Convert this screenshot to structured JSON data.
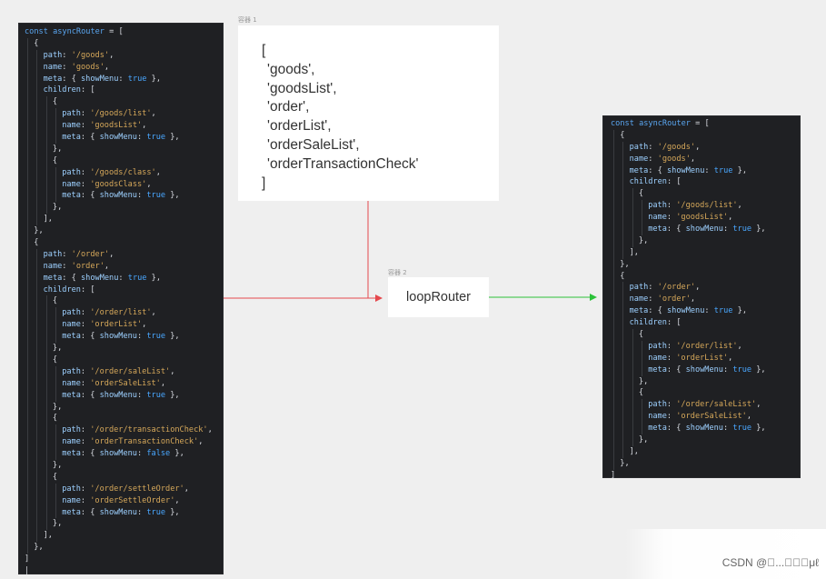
{
  "container_labels": {
    "container_1": "容器 1",
    "container_2": "容器 2"
  },
  "array_box": {
    "open": "[",
    "items": [
      "'goods',",
      "'goodsList',",
      "'order',",
      "'orderList',",
      "'orderSaleList',",
      "'orderTransactionCheck'"
    ],
    "close": "]"
  },
  "loop_box": {
    "label": "loopRouter"
  },
  "arrow_colors": {
    "red": "#e5484d",
    "green": "#2cc23a"
  },
  "left_code": [
    {
      "indent": 0,
      "parts": [
        [
          "kw",
          "const"
        ],
        [
          "t",
          " "
        ],
        [
          "kw",
          "asyncRouter"
        ],
        [
          "t",
          " = ["
        ]
      ]
    },
    {
      "indent": 1,
      "parts": [
        [
          "t",
          "{"
        ]
      ]
    },
    {
      "indent": 2,
      "parts": [
        [
          "key",
          "path"
        ],
        [
          "t",
          ": "
        ],
        [
          "str",
          "'/goods'"
        ],
        [
          "t",
          ","
        ]
      ]
    },
    {
      "indent": 2,
      "parts": [
        [
          "key",
          "name"
        ],
        [
          "t",
          ": "
        ],
        [
          "str",
          "'goods'"
        ],
        [
          "t",
          ","
        ]
      ]
    },
    {
      "indent": 2,
      "parts": [
        [
          "key",
          "meta"
        ],
        [
          "t",
          ": { "
        ],
        [
          "key",
          "showMenu"
        ],
        [
          "t",
          ": "
        ],
        [
          "bool",
          "true"
        ],
        [
          "t",
          " },"
        ]
      ]
    },
    {
      "indent": 2,
      "parts": [
        [
          "key",
          "children"
        ],
        [
          "t",
          ": ["
        ]
      ]
    },
    {
      "indent": 3,
      "parts": [
        [
          "t",
          "{"
        ]
      ]
    },
    {
      "indent": 4,
      "parts": [
        [
          "key",
          "path"
        ],
        [
          "t",
          ": "
        ],
        [
          "str",
          "'/goods/list'"
        ],
        [
          "t",
          ","
        ]
      ]
    },
    {
      "indent": 4,
      "parts": [
        [
          "key",
          "name"
        ],
        [
          "t",
          ": "
        ],
        [
          "str",
          "'goodsList'"
        ],
        [
          "t",
          ","
        ]
      ]
    },
    {
      "indent": 4,
      "parts": [
        [
          "key",
          "meta"
        ],
        [
          "t",
          ": { "
        ],
        [
          "key",
          "showMenu"
        ],
        [
          "t",
          ": "
        ],
        [
          "bool",
          "true"
        ],
        [
          "t",
          " },"
        ]
      ]
    },
    {
      "indent": 3,
      "parts": [
        [
          "t",
          "},"
        ]
      ]
    },
    {
      "indent": 3,
      "parts": [
        [
          "t",
          "{"
        ]
      ]
    },
    {
      "indent": 4,
      "parts": [
        [
          "key",
          "path"
        ],
        [
          "t",
          ": "
        ],
        [
          "str",
          "'/goods/class'"
        ],
        [
          "t",
          ","
        ]
      ]
    },
    {
      "indent": 4,
      "parts": [
        [
          "key",
          "name"
        ],
        [
          "t",
          ": "
        ],
        [
          "str",
          "'goodsClass'"
        ],
        [
          "t",
          ","
        ]
      ]
    },
    {
      "indent": 4,
      "parts": [
        [
          "key",
          "meta"
        ],
        [
          "t",
          ": { "
        ],
        [
          "key",
          "showMenu"
        ],
        [
          "t",
          ": "
        ],
        [
          "bool",
          "true"
        ],
        [
          "t",
          " },"
        ]
      ]
    },
    {
      "indent": 3,
      "parts": [
        [
          "t",
          "},"
        ]
      ]
    },
    {
      "indent": 2,
      "parts": [
        [
          "t",
          "],"
        ]
      ]
    },
    {
      "indent": 1,
      "parts": [
        [
          "t",
          "},"
        ]
      ]
    },
    {
      "indent": 1,
      "parts": [
        [
          "t",
          "{"
        ]
      ]
    },
    {
      "indent": 2,
      "parts": [
        [
          "key",
          "path"
        ],
        [
          "t",
          ": "
        ],
        [
          "str",
          "'/order'"
        ],
        [
          "t",
          ","
        ]
      ]
    },
    {
      "indent": 2,
      "parts": [
        [
          "key",
          "name"
        ],
        [
          "t",
          ": "
        ],
        [
          "str",
          "'order'"
        ],
        [
          "t",
          ","
        ]
      ]
    },
    {
      "indent": 2,
      "parts": [
        [
          "key",
          "meta"
        ],
        [
          "t",
          ": { "
        ],
        [
          "key",
          "showMenu"
        ],
        [
          "t",
          ": "
        ],
        [
          "bool",
          "true"
        ],
        [
          "t",
          " },"
        ]
      ]
    },
    {
      "indent": 2,
      "parts": [
        [
          "key",
          "children"
        ],
        [
          "t",
          ": ["
        ]
      ]
    },
    {
      "indent": 3,
      "parts": [
        [
          "t",
          "{"
        ]
      ]
    },
    {
      "indent": 4,
      "parts": [
        [
          "key",
          "path"
        ],
        [
          "t",
          ": "
        ],
        [
          "str",
          "'/order/list'"
        ],
        [
          "t",
          ","
        ]
      ]
    },
    {
      "indent": 4,
      "parts": [
        [
          "key",
          "name"
        ],
        [
          "t",
          ": "
        ],
        [
          "str",
          "'orderList'"
        ],
        [
          "t",
          ","
        ]
      ]
    },
    {
      "indent": 4,
      "parts": [
        [
          "key",
          "meta"
        ],
        [
          "t",
          ": { "
        ],
        [
          "key",
          "showMenu"
        ],
        [
          "t",
          ": "
        ],
        [
          "bool",
          "true"
        ],
        [
          "t",
          " },"
        ]
      ]
    },
    {
      "indent": 3,
      "parts": [
        [
          "t",
          "},"
        ]
      ]
    },
    {
      "indent": 3,
      "parts": [
        [
          "t",
          "{"
        ]
      ]
    },
    {
      "indent": 4,
      "parts": [
        [
          "key",
          "path"
        ],
        [
          "t",
          ": "
        ],
        [
          "str",
          "'/order/saleList'"
        ],
        [
          "t",
          ","
        ]
      ]
    },
    {
      "indent": 4,
      "parts": [
        [
          "key",
          "name"
        ],
        [
          "t",
          ": "
        ],
        [
          "str",
          "'orderSaleList'"
        ],
        [
          "t",
          ","
        ]
      ]
    },
    {
      "indent": 4,
      "parts": [
        [
          "key",
          "meta"
        ],
        [
          "t",
          ": { "
        ],
        [
          "key",
          "showMenu"
        ],
        [
          "t",
          ": "
        ],
        [
          "bool",
          "true"
        ],
        [
          "t",
          " },"
        ]
      ]
    },
    {
      "indent": 3,
      "parts": [
        [
          "t",
          "},"
        ]
      ]
    },
    {
      "indent": 3,
      "parts": [
        [
          "t",
          "{"
        ]
      ]
    },
    {
      "indent": 4,
      "parts": [
        [
          "key",
          "path"
        ],
        [
          "t",
          ": "
        ],
        [
          "str",
          "'/order/transactionCheck'"
        ],
        [
          "t",
          ","
        ]
      ]
    },
    {
      "indent": 4,
      "parts": [
        [
          "key",
          "name"
        ],
        [
          "t",
          ": "
        ],
        [
          "str",
          "'orderTransactionCheck'"
        ],
        [
          "t",
          ","
        ]
      ]
    },
    {
      "indent": 4,
      "parts": [
        [
          "key",
          "meta"
        ],
        [
          "t",
          ": { "
        ],
        [
          "key",
          "showMenu"
        ],
        [
          "t",
          ": "
        ],
        [
          "bool",
          "false"
        ],
        [
          "t",
          " },"
        ]
      ]
    },
    {
      "indent": 3,
      "parts": [
        [
          "t",
          "},"
        ]
      ]
    },
    {
      "indent": 3,
      "parts": [
        [
          "t",
          "{"
        ]
      ]
    },
    {
      "indent": 4,
      "parts": [
        [
          "key",
          "path"
        ],
        [
          "t",
          ": "
        ],
        [
          "str",
          "'/order/settleOrder'"
        ],
        [
          "t",
          ","
        ]
      ]
    },
    {
      "indent": 4,
      "parts": [
        [
          "key",
          "name"
        ],
        [
          "t",
          ": "
        ],
        [
          "str",
          "'orderSettleOrder'"
        ],
        [
          "t",
          ","
        ]
      ]
    },
    {
      "indent": 4,
      "parts": [
        [
          "key",
          "meta"
        ],
        [
          "t",
          ": { "
        ],
        [
          "key",
          "showMenu"
        ],
        [
          "t",
          ": "
        ],
        [
          "bool",
          "true"
        ],
        [
          "t",
          " },"
        ]
      ]
    },
    {
      "indent": 3,
      "parts": [
        [
          "t",
          "},"
        ]
      ]
    },
    {
      "indent": 2,
      "parts": [
        [
          "t",
          "],"
        ]
      ]
    },
    {
      "indent": 1,
      "parts": [
        [
          "t",
          "},"
        ]
      ]
    },
    {
      "indent": 0,
      "parts": [
        [
          "t",
          "]"
        ]
      ]
    },
    {
      "indent": 0,
      "parts": [
        [
          "t",
          "|"
        ]
      ]
    }
  ],
  "right_code": [
    {
      "indent": 0,
      "parts": [
        [
          "kw",
          "const"
        ],
        [
          "t",
          " "
        ],
        [
          "kw",
          "asyncRouter"
        ],
        [
          "t",
          " = ["
        ]
      ]
    },
    {
      "indent": 1,
      "parts": [
        [
          "t",
          "{"
        ]
      ]
    },
    {
      "indent": 2,
      "parts": [
        [
          "key",
          "path"
        ],
        [
          "t",
          ": "
        ],
        [
          "str",
          "'/goods'"
        ],
        [
          "t",
          ","
        ]
      ]
    },
    {
      "indent": 2,
      "parts": [
        [
          "key",
          "name"
        ],
        [
          "t",
          ": "
        ],
        [
          "str",
          "'goods'"
        ],
        [
          "t",
          ","
        ]
      ]
    },
    {
      "indent": 2,
      "parts": [
        [
          "key",
          "meta"
        ],
        [
          "t",
          ": { "
        ],
        [
          "key",
          "showMenu"
        ],
        [
          "t",
          ": "
        ],
        [
          "bool",
          "true"
        ],
        [
          "t",
          " },"
        ]
      ]
    },
    {
      "indent": 2,
      "parts": [
        [
          "key",
          "children"
        ],
        [
          "t",
          ": ["
        ]
      ]
    },
    {
      "indent": 3,
      "parts": [
        [
          "t",
          "{"
        ]
      ]
    },
    {
      "indent": 4,
      "parts": [
        [
          "key",
          "path"
        ],
        [
          "t",
          ": "
        ],
        [
          "str",
          "'/goods/list'"
        ],
        [
          "t",
          ","
        ]
      ]
    },
    {
      "indent": 4,
      "parts": [
        [
          "key",
          "name"
        ],
        [
          "t",
          ": "
        ],
        [
          "str",
          "'goodsList'"
        ],
        [
          "t",
          ","
        ]
      ]
    },
    {
      "indent": 4,
      "parts": [
        [
          "key",
          "meta"
        ],
        [
          "t",
          ": { "
        ],
        [
          "key",
          "showMenu"
        ],
        [
          "t",
          ": "
        ],
        [
          "bool",
          "true"
        ],
        [
          "t",
          " },"
        ]
      ]
    },
    {
      "indent": 3,
      "parts": [
        [
          "t",
          "},"
        ]
      ]
    },
    {
      "indent": 2,
      "parts": [
        [
          "t",
          "],"
        ]
      ]
    },
    {
      "indent": 1,
      "parts": [
        [
          "t",
          "},"
        ]
      ]
    },
    {
      "indent": 1,
      "parts": [
        [
          "t",
          "{"
        ]
      ]
    },
    {
      "indent": 2,
      "parts": [
        [
          "key",
          "path"
        ],
        [
          "t",
          ": "
        ],
        [
          "str",
          "'/order'"
        ],
        [
          "t",
          ","
        ]
      ]
    },
    {
      "indent": 2,
      "parts": [
        [
          "key",
          "name"
        ],
        [
          "t",
          ": "
        ],
        [
          "str",
          "'order'"
        ],
        [
          "t",
          ","
        ]
      ]
    },
    {
      "indent": 2,
      "parts": [
        [
          "key",
          "meta"
        ],
        [
          "t",
          ": { "
        ],
        [
          "key",
          "showMenu"
        ],
        [
          "t",
          ": "
        ],
        [
          "bool",
          "true"
        ],
        [
          "t",
          " },"
        ]
      ]
    },
    {
      "indent": 2,
      "parts": [
        [
          "key",
          "children"
        ],
        [
          "t",
          ": ["
        ]
      ]
    },
    {
      "indent": 3,
      "parts": [
        [
          "t",
          "{"
        ]
      ]
    },
    {
      "indent": 4,
      "parts": [
        [
          "key",
          "path"
        ],
        [
          "t",
          ": "
        ],
        [
          "str",
          "'/order/list'"
        ],
        [
          "t",
          ","
        ]
      ]
    },
    {
      "indent": 4,
      "parts": [
        [
          "key",
          "name"
        ],
        [
          "t",
          ": "
        ],
        [
          "str",
          "'orderList'"
        ],
        [
          "t",
          ","
        ]
      ]
    },
    {
      "indent": 4,
      "parts": [
        [
          "key",
          "meta"
        ],
        [
          "t",
          ": { "
        ],
        [
          "key",
          "showMenu"
        ],
        [
          "t",
          ": "
        ],
        [
          "bool",
          "true"
        ],
        [
          "t",
          " },"
        ]
      ]
    },
    {
      "indent": 3,
      "parts": [
        [
          "t",
          "},"
        ]
      ]
    },
    {
      "indent": 3,
      "parts": [
        [
          "t",
          "{"
        ]
      ]
    },
    {
      "indent": 4,
      "parts": [
        [
          "key",
          "path"
        ],
        [
          "t",
          ": "
        ],
        [
          "str",
          "'/order/saleList'"
        ],
        [
          "t",
          ","
        ]
      ]
    },
    {
      "indent": 4,
      "parts": [
        [
          "key",
          "name"
        ],
        [
          "t",
          ": "
        ],
        [
          "str",
          "'orderSaleList'"
        ],
        [
          "t",
          ","
        ]
      ]
    },
    {
      "indent": 4,
      "parts": [
        [
          "key",
          "meta"
        ],
        [
          "t",
          ": { "
        ],
        [
          "key",
          "showMenu"
        ],
        [
          "t",
          ": "
        ],
        [
          "bool",
          "true"
        ],
        [
          "t",
          " },"
        ]
      ]
    },
    {
      "indent": 3,
      "parts": [
        [
          "t",
          "},"
        ]
      ]
    },
    {
      "indent": 2,
      "parts": [
        [
          "t",
          "],"
        ]
      ]
    },
    {
      "indent": 1,
      "parts": [
        [
          "t",
          "},"
        ]
      ]
    },
    {
      "indent": 0,
      "parts": [
        [
          "t",
          "]"
        ]
      ]
    }
  ],
  "watermark": "CSDN @\u0000...\u0000\u0000\u0000μℓ"
}
